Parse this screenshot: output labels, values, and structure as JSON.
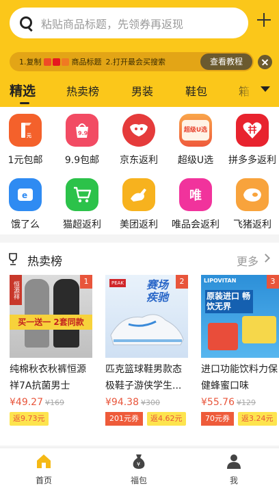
{
  "search": {
    "placeholder": "粘贴商品标题，先领券再返现"
  },
  "tip": {
    "step1": "1.复制",
    "step1_suffix": "商品标题",
    "step2": "2.打开最会买搜索",
    "button": "查看教程"
  },
  "tabs": [
    "精选",
    "热卖榜",
    "男装",
    "鞋包",
    "箱"
  ],
  "categories": [
    {
      "label": "1元包邮",
      "icon_text": "1",
      "color": "#f4612b"
    },
    {
      "label": "9.9包邮",
      "icon_text": "9.9",
      "color": "#f24b63"
    },
    {
      "label": "京东返利",
      "icon_text": "",
      "color": "#e53b3b"
    },
    {
      "label": "超级U选",
      "icon_text": "超级U选",
      "color": "#f28a3c"
    },
    {
      "label": "拼多多返利",
      "icon_text": "",
      "color": "#e8232e"
    },
    {
      "label": "饿了么",
      "icon_text": "e",
      "color": "#2f8bf2"
    },
    {
      "label": "猫超返利",
      "icon_text": "",
      "color": "#2cc24a"
    },
    {
      "label": "美团返利",
      "icon_text": "",
      "color": "#f7b21e"
    },
    {
      "label": "唯品会返利",
      "icon_text": "唯",
      "color": "#f1339c"
    },
    {
      "label": "飞猪返利",
      "icon_text": "",
      "color": "#f8a33c"
    }
  ],
  "hot": {
    "title": "热卖榜",
    "more": "更多",
    "items": [
      {
        "rank": "1",
        "name": "纯棉秋衣秋裤恒源祥7A抗菌男士",
        "price": "¥49.27",
        "orig": "¥169",
        "coupon": "",
        "rebate": "返9.73元",
        "img_text": "买一送一 2套同款"
      },
      {
        "rank": "2",
        "name": "匹克篮球鞋男款态极鞋子游侠学生...",
        "price": "¥94.38",
        "orig": "¥300",
        "coupon": "201元券",
        "rebate": "返4.62元",
        "img_text": "赛场疾驰"
      },
      {
        "rank": "3",
        "name": "进口功能饮料力保健蜂蜜口味",
        "price": "¥55.76",
        "orig": "¥129",
        "coupon": "70元券",
        "rebate": "返3.24元",
        "img_text": "原装进口 畅饮无界"
      }
    ]
  },
  "bottom_nav": [
    {
      "label": "首页"
    },
    {
      "label": "福包"
    },
    {
      "label": "我"
    }
  ]
}
